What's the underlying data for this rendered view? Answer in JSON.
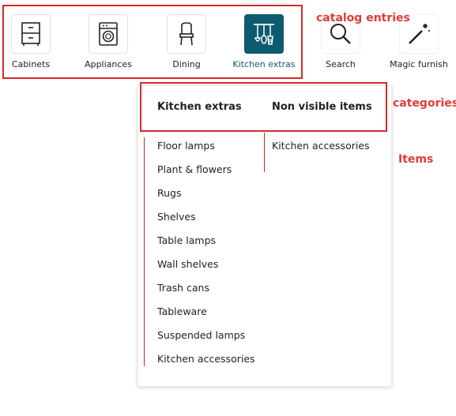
{
  "toolbar": {
    "items": [
      {
        "label": "Cabinets",
        "icon": "cabinet-icon"
      },
      {
        "label": "Appliances",
        "icon": "washing-machine-icon"
      },
      {
        "label": "Dining",
        "icon": "chair-icon"
      },
      {
        "label": "Kitchen extras",
        "icon": "kitchen-utensils-icon",
        "active": true
      },
      {
        "label": "Search",
        "icon": "search-icon"
      },
      {
        "label": "Magic furnish",
        "icon": "magic-wand-icon"
      }
    ]
  },
  "annotations": {
    "catalog_entries": "catalog entries",
    "categories": "categories",
    "items": "Items"
  },
  "dropdown": {
    "categories": [
      "Kitchen extras",
      "Non visible items"
    ],
    "column1_items": [
      "Floor lamps",
      "Plant & flowers",
      "Rugs",
      "Shelves",
      "Table lamps",
      "Wall shelves",
      "Trash cans",
      "Tableware",
      "Suspended lamps",
      "Kitchen accessories"
    ],
    "column2_items": [
      "Kitchen accessories"
    ]
  },
  "colors": {
    "accent": "#0e5a6e",
    "annotation": "#e03c3c"
  }
}
